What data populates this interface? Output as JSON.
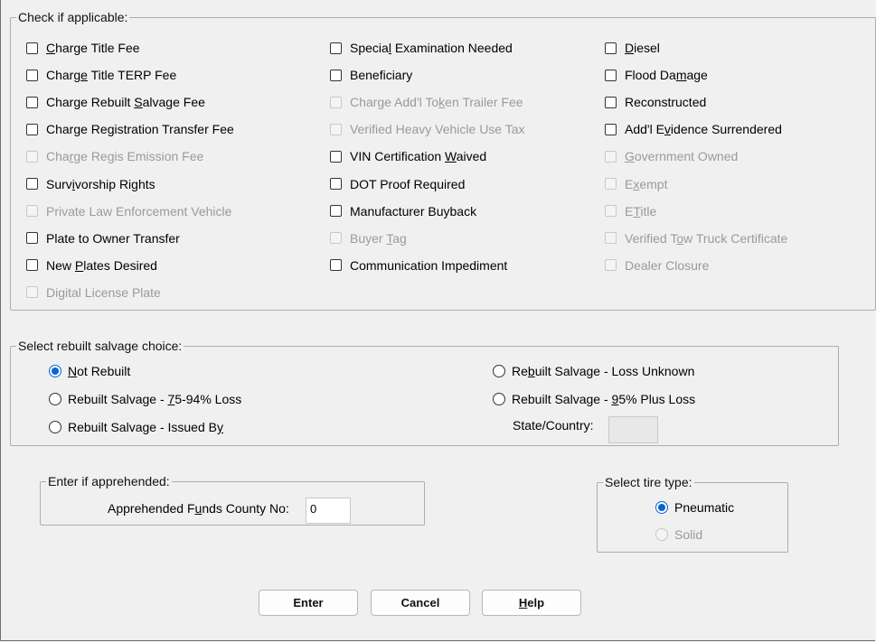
{
  "applicable": {
    "legend": "Check if applicable:",
    "col1": [
      {
        "pre": "",
        "u": "C",
        "post": "harge Title Fee",
        "disabled": false
      },
      {
        "pre": "Charg",
        "u": "e",
        "post": " Title TERP Fee",
        "disabled": false
      },
      {
        "pre": "Charge Rebuilt ",
        "u": "S",
        "post": "alvage Fee",
        "disabled": false
      },
      {
        "pre": "Charge Registration Transfer Fee",
        "u": "",
        "post": "",
        "disabled": false
      },
      {
        "pre": "Cha",
        "u": "r",
        "post": "ge Regis Emission Fee",
        "disabled": true
      },
      {
        "pre": "Surv",
        "u": "i",
        "post": "vorship Rights",
        "disabled": false
      },
      {
        "pre": "Private Law Enforcement Vehicle",
        "u": "",
        "post": "",
        "disabled": true
      },
      {
        "pre": "Plate to Owner Transfer",
        "u": "",
        "post": "",
        "disabled": false
      },
      {
        "pre": "New ",
        "u": "P",
        "post": "lates Desired",
        "disabled": false
      },
      {
        "pre": "Digital License Plate",
        "u": "",
        "post": "",
        "disabled": true
      }
    ],
    "col2": [
      {
        "pre": "Specia",
        "u": "l",
        "post": " Examination Needed",
        "disabled": false
      },
      {
        "pre": "Beneficiary",
        "u": "",
        "post": "",
        "disabled": false
      },
      {
        "pre": "Charge Add'l To",
        "u": "k",
        "post": "en Trailer Fee",
        "disabled": true
      },
      {
        "pre": "Verified Heavy Vehicle Use Tax",
        "u": "",
        "post": "",
        "disabled": true
      },
      {
        "pre": "VIN Certification ",
        "u": "W",
        "post": "aived",
        "disabled": false
      },
      {
        "pre": "DOT Proof Required",
        "u": "",
        "post": "",
        "disabled": false
      },
      {
        "pre": "Manufacturer Buyback",
        "u": "",
        "post": "",
        "disabled": false
      },
      {
        "pre": "Buyer ",
        "u": "T",
        "post": "ag",
        "disabled": true
      },
      {
        "pre": "Communication Impediment",
        "u": "",
        "post": "",
        "disabled": false
      }
    ],
    "col3": [
      {
        "pre": "",
        "u": "D",
        "post": "iesel",
        "disabled": false
      },
      {
        "pre": "Flood Da",
        "u": "m",
        "post": "age",
        "disabled": false
      },
      {
        "pre": "Reconstructed",
        "u": "",
        "post": "",
        "disabled": false
      },
      {
        "pre": "Add'l E",
        "u": "v",
        "post": "idence Surrendered",
        "disabled": false
      },
      {
        "pre": "",
        "u": "G",
        "post": "overnment Owned",
        "disabled": true
      },
      {
        "pre": "E",
        "u": "x",
        "post": "empt",
        "disabled": true
      },
      {
        "pre": "E",
        "u": "T",
        "post": "itle",
        "disabled": true
      },
      {
        "pre": "Verified T",
        "u": "o",
        "post": "w Truck Certificate",
        "disabled": true
      },
      {
        "pre": "Dealer Closure",
        "u": "",
        "post": "",
        "disabled": true
      }
    ]
  },
  "salvage": {
    "legend": "Select rebuilt salvage choice:",
    "left": [
      {
        "pre": "",
        "u": "N",
        "post": "ot Rebuilt",
        "checked": true
      },
      {
        "pre": "Rebuilt Salvage - ",
        "u": "7",
        "post": "5-94% Loss",
        "checked": false
      },
      {
        "pre": "Rebuilt Salvage - Issued B",
        "u": "y",
        "post": "",
        "checked": false
      }
    ],
    "right": [
      {
        "pre": "Re",
        "u": "b",
        "post": "uilt Salvage - Loss Unknown",
        "checked": false
      },
      {
        "pre": "Rebuilt Salvage - ",
        "u": "9",
        "post": "5% Plus Loss",
        "checked": false
      }
    ],
    "state_label": "State/Country:",
    "state_value": ""
  },
  "apprehended": {
    "legend": "Enter if apprehended:",
    "label_pre": "Apprehended F",
    "label_u": "u",
    "label_post": "nds County No:",
    "value": "0"
  },
  "tire": {
    "legend": "Select tire type:",
    "options": [
      {
        "label": "Pneumatic",
        "checked": true,
        "disabled": false
      },
      {
        "label": "Solid",
        "checked": false,
        "disabled": true
      }
    ]
  },
  "buttons": {
    "enter": "Enter",
    "cancel": "Cancel",
    "help_u": "H",
    "help_post": "elp"
  },
  "colors": {
    "radio_checked": "#0a64d6",
    "disabled_text": "#9a9a9a"
  }
}
